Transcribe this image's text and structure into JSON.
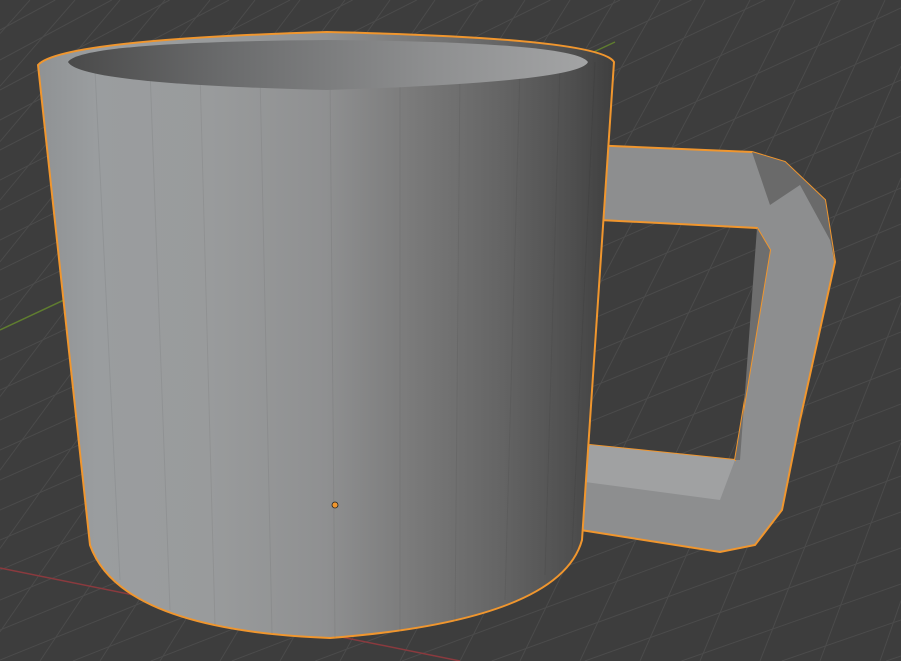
{
  "viewport": {
    "object": "mug",
    "selected": true,
    "colors": {
      "background": "#3d3d3d",
      "grid": "#4a4a4a",
      "x_axis": "#8a3a3e",
      "y_axis": "#5f7d2f",
      "selection_outline": "#f0962e",
      "origin": "#f0962e",
      "mesh_light": "#9c9e a0",
      "mesh_dark": "#444444"
    }
  }
}
